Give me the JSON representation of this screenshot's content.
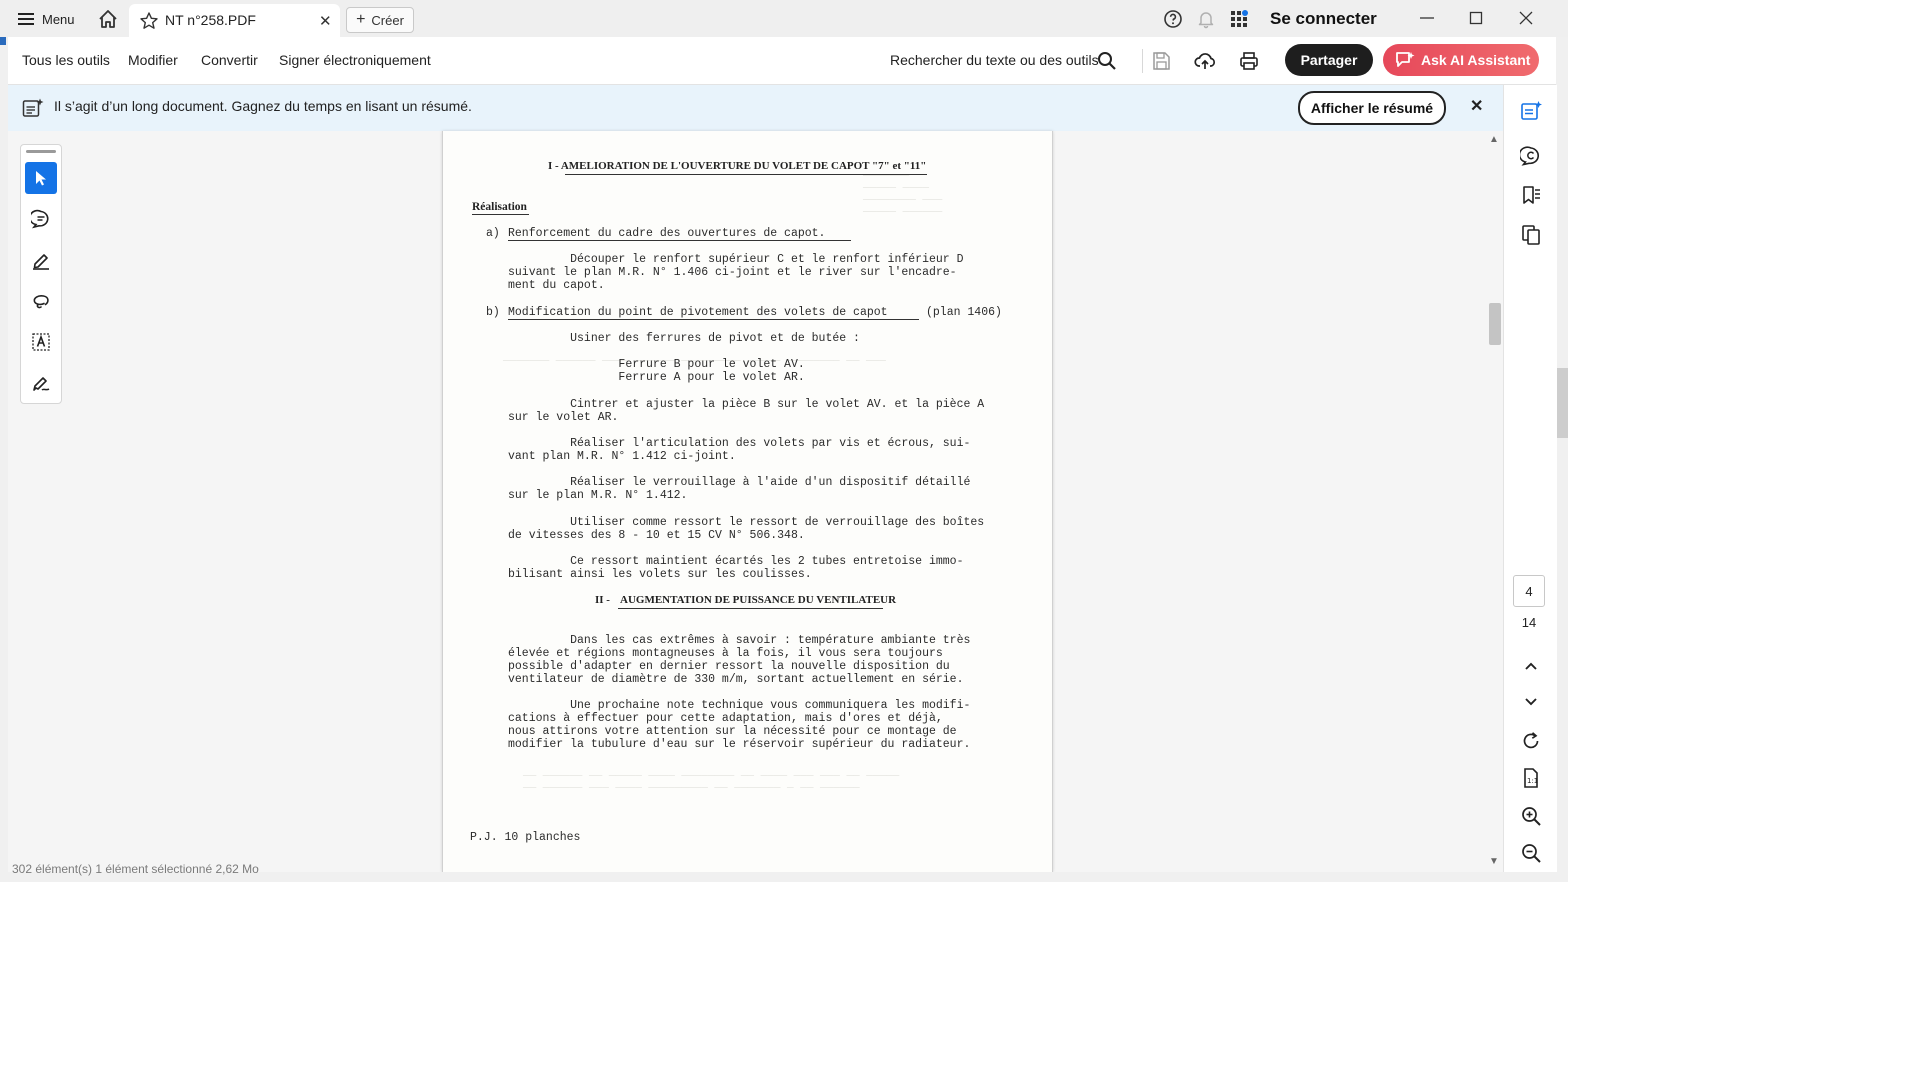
{
  "titlebar": {
    "menu_label": "Menu",
    "tab_title": "NT n°258.PDF",
    "tab_close": "✕",
    "create_label": "Créer",
    "signin_label": "Se connecter"
  },
  "toolbar": {
    "menus": [
      "Tous les outils",
      "Modifier",
      "Convertir",
      "Signer électroniquement"
    ],
    "search_label": "Rechercher du texte ou des outils",
    "share_label": "Partager",
    "ai_label": "Ask AI Assistant"
  },
  "banner": {
    "text": "Il s’agit d’un long document. Gagnez du temps en lisant un résumé.",
    "summary_button": "Afficher le résumé",
    "close": "✕"
  },
  "pager": {
    "current_page": "4",
    "total_pages": "14"
  },
  "status_bar": {
    "text": "302 élément(s)     1 élément sélectionné  2,62 Mo"
  },
  "document": {
    "heading1": "I - AMELIORATION DE L'OUVERTURE DU VOLET DE CAPOT \"7\" et \"11\"",
    "realisation": "Réalisation",
    "a_prefix": "a)",
    "a_title": "Renforcement du cadre des ouvertures de capot.",
    "a_body": "         Découper le renfort supérieur C et le renfort inférieur D\nsuivant le plan M.R. N° 1.406 ci-joint et le river sur l'encadre-\nment du capot.",
    "b_prefix": "b)",
    "b_title": "Modification du point de pivotement des volets de capot",
    "b_suffix": "(plan 1406)",
    "b_line1": "         Usiner des ferrures de pivot et de butée :",
    "ferrures": "                Ferrure B pour le volet AV.\n                Ferrure A pour le volet AR.",
    "para_cintrer": "         Cintrer et ajuster la pièce B sur le volet AV. et la pièce A\nsur le volet AR.",
    "para_articulation": "         Réaliser l'articulation des volets par vis et écrous, sui-\nvant plan M.R. N° 1.412 ci-joint.",
    "para_verrouillage": "         Réaliser le verrouillage à l'aide d'un dispositif détaillé\nsur le plan M.R. N° 1.412.",
    "para_ressort": "         Utiliser comme ressort le ressort de verrouillage des boîtes\nde vitesses des 8 - 10 et 15 CV N° 506.348.",
    "para_maintient": "         Ce ressort maintient écartés les 2 tubes entretoise immo-\nbilisant ainsi les volets sur les coulisses.",
    "heading2_prefix": "II -",
    "heading2_title": "AUGMENTATION DE PUISSANCE DU VENTILATEUR",
    "para_extremes": "         Dans les cas extrêmes à savoir : température ambiante très\nélevée et régions montagneuses à la fois, il vous sera toujours\npossible d'adapter en dernier ressort la nouvelle disposition du\nventilateur de diamètre de 330 m/m, sortant actuellement en série.",
    "para_prochaine": "         Une prochaine note technique vous communiquera les modifi-\ncations à effectuer pour cette adaptation, mais d'ores et déjà,\nnous attirons votre attention sur la nécessité pour ce montage de\nmodifier la tubulure d'eau sur le réservoir supérieur du radiateur.",
    "pj": "P.J. 10 planches"
  },
  "icons": {
    "home": "home-icon",
    "star": "star-icon",
    "help": "help-icon",
    "bell": "bell-icon",
    "apps": "apps-icon",
    "search": "search-icon",
    "save": "save-icon",
    "upload": "upload-cloud-icon",
    "print": "print-icon"
  },
  "colors": {
    "select_tool_blue": "#1473e6",
    "banner_bg": "#e8f3fb",
    "share_bg": "#1e1e1e",
    "ai_gradient_start": "#e6485a"
  }
}
